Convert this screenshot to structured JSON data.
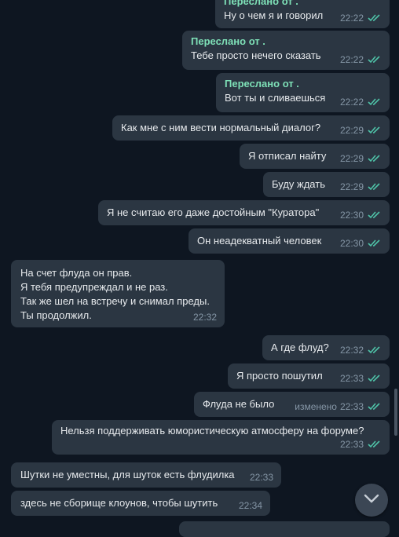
{
  "messages": [
    {
      "id": "m1",
      "side": "out",
      "forwarded": "Переслано от .",
      "text": "Ну о чем я и говорил",
      "time": "22:22",
      "read": true
    },
    {
      "id": "m2",
      "side": "out",
      "forwarded": "Переслано от .",
      "text": "Тебе просто нечего сказать",
      "time": "22:22",
      "read": true
    },
    {
      "id": "m3",
      "side": "out",
      "forwarded": "Переслано от .",
      "text": "Вот ты и сливаешься",
      "time": "22:22",
      "read": true
    },
    {
      "id": "m4",
      "side": "out",
      "text": "Как мне с ним вести нормальный диалог?",
      "time": "22:29",
      "read": true
    },
    {
      "id": "m5",
      "side": "out",
      "text": "Я отписал найту",
      "time": "22:29",
      "read": true
    },
    {
      "id": "m6",
      "side": "out",
      "text": "Буду ждать",
      "time": "22:29",
      "read": true
    },
    {
      "id": "m7",
      "side": "out",
      "text": "Я не считаю его даже достойным \"Куратора\"",
      "time": "22:30",
      "read": true
    },
    {
      "id": "m8",
      "side": "out",
      "text": "Он неадекватный человек",
      "time": "22:30",
      "read": true
    },
    {
      "id": "m9",
      "side": "in",
      "text": "На счет флуда он прав.\nЯ тебя предупреждал и не раз.\nТак же шел на встречу и снимал преды.\nТы продолжил.",
      "time": "22:32"
    },
    {
      "id": "m10",
      "side": "out",
      "text": "А где флуд?",
      "time": "22:32",
      "read": true
    },
    {
      "id": "m11",
      "side": "out",
      "text": "Я просто пошутил",
      "time": "22:33",
      "read": true
    },
    {
      "id": "m12",
      "side": "out",
      "text": "Флуда не было",
      "edited": "изменено",
      "time": "22:33",
      "read": true
    },
    {
      "id": "m13",
      "side": "out",
      "text": "Нельзя поддерживать юмористическую атмосферу на форуме?",
      "time": "22:33",
      "read": true
    },
    {
      "id": "m14",
      "side": "in",
      "text": "Шутки не уместны, для шуток есть флудилка",
      "time": "22:33"
    },
    {
      "id": "m15",
      "side": "in",
      "text": "здесь не сборище клоунов, чтобы шутить",
      "time": "22:34"
    }
  ],
  "colors": {
    "background": "#0e1621",
    "bubble": "#2b3642",
    "forward_name": "#7ee0b7",
    "read_ticks": "#4fc3a8",
    "time": "#8596a6"
  },
  "icons": {
    "read": "double-check-icon",
    "scroll_down": "chevron-down-icon"
  }
}
